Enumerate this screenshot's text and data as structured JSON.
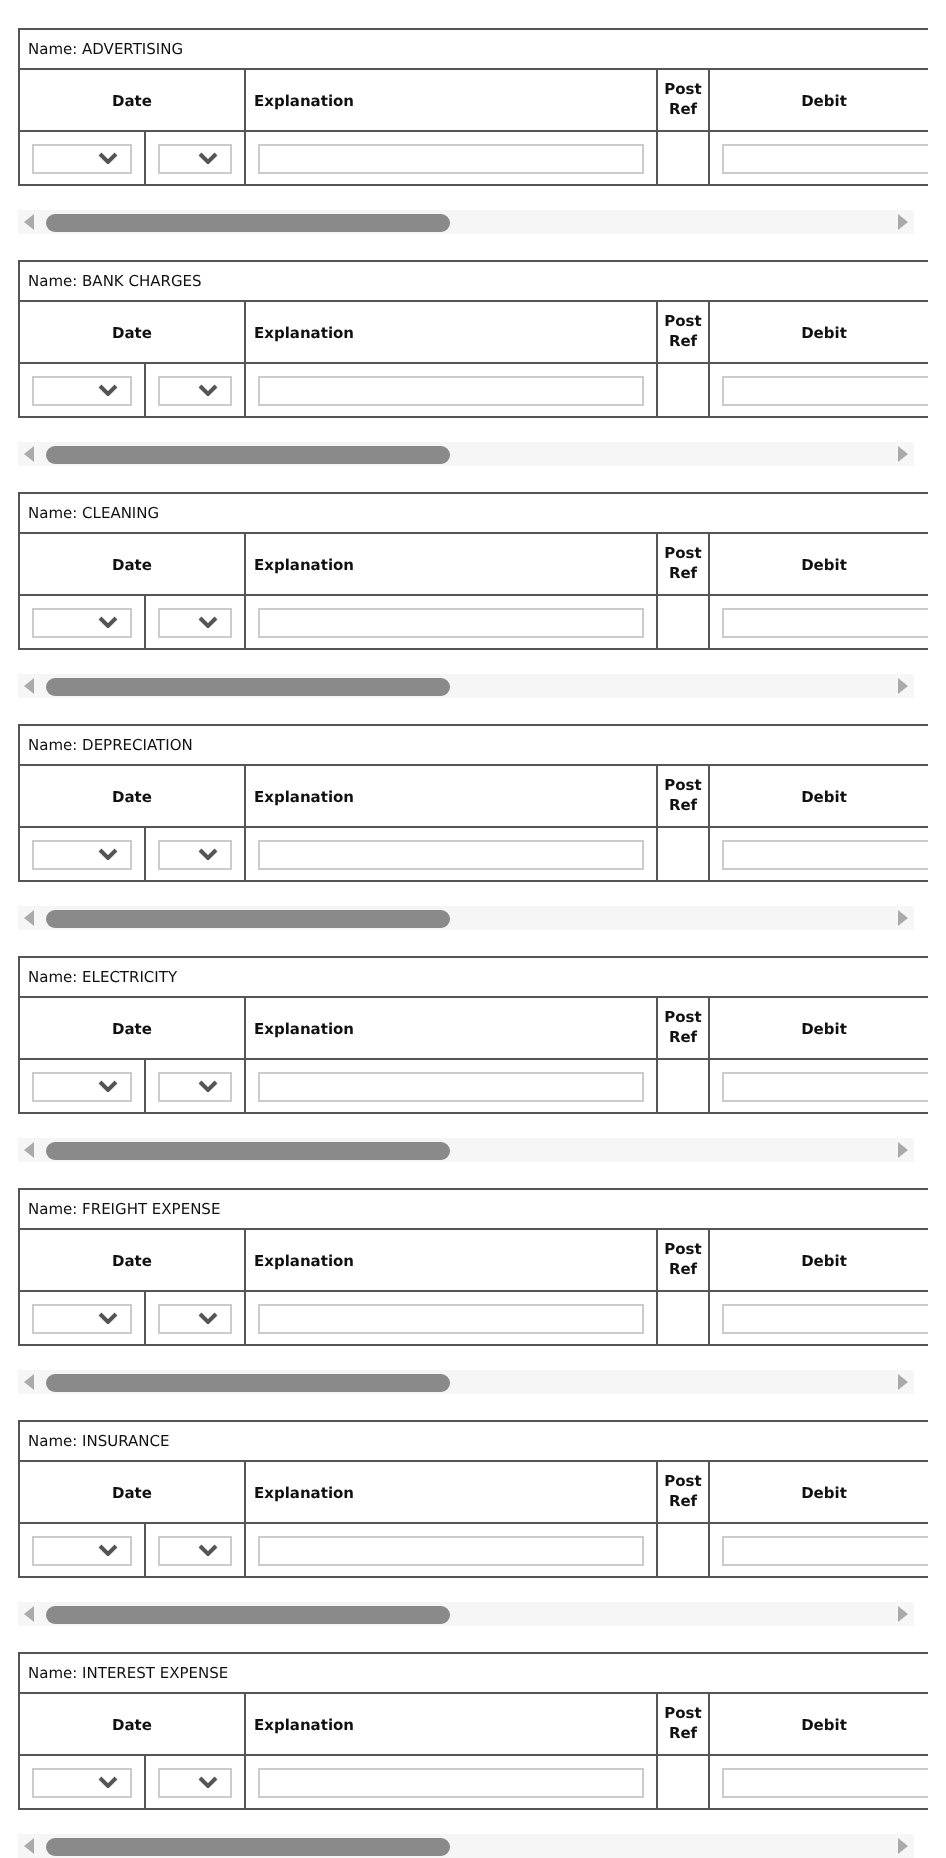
{
  "ledgers": [
    {
      "title": "Name: ADVERTISING",
      "columns": [
        "Date",
        "Explanation",
        "Post Ref",
        "Debit"
      ]
    },
    {
      "title": "Name: BANK CHARGES",
      "columns": [
        "Date",
        "Explanation",
        "Post Ref",
        "Debit"
      ]
    },
    {
      "title": "Name: CLEANING",
      "columns": [
        "Date",
        "Explanation",
        "Post Ref",
        "Debit"
      ]
    },
    {
      "title": "Name: DEPRECIATION",
      "columns": [
        "Date",
        "Explanation",
        "Post Ref",
        "Debit"
      ]
    },
    {
      "title": "Name: ELECTRICITY",
      "columns": [
        "Date",
        "Explanation",
        "Post Ref",
        "Debit"
      ]
    },
    {
      "title": "Name: FREIGHT EXPENSE",
      "columns": [
        "Date",
        "Explanation",
        "Post Ref",
        "Debit"
      ]
    },
    {
      "title": "Name: INSURANCE",
      "columns": [
        "Date",
        "Explanation",
        "Post Ref",
        "Debit"
      ]
    },
    {
      "title": "Name: INTEREST EXPENSE",
      "columns": [
        "Date",
        "Explanation",
        "Post Ref",
        "Debit"
      ]
    }
  ]
}
